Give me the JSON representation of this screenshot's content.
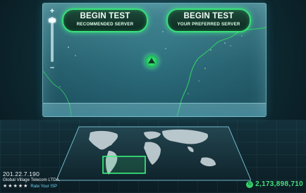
{
  "buttons": [
    {
      "main": "BEGIN TEST",
      "sub": "RECOMMENDED SERVER"
    },
    {
      "main": "BEGIN TEST",
      "sub": "YOUR PREFERRED SERVER"
    }
  ],
  "zoom": {
    "plus": "+",
    "minus": "–",
    "level": 0.85
  },
  "isp": {
    "ip": "201.22.7.190",
    "name": "Global Village Telecom LTDA.",
    "stars": 5,
    "rate_label": "Rate Your ISP"
  },
  "counter": {
    "value": "2,173,898,710",
    "icon": "refresh-icon"
  },
  "colors": {
    "accent": "#39e07a",
    "counter": "#45e07c",
    "glass": "#6ec8d7"
  }
}
